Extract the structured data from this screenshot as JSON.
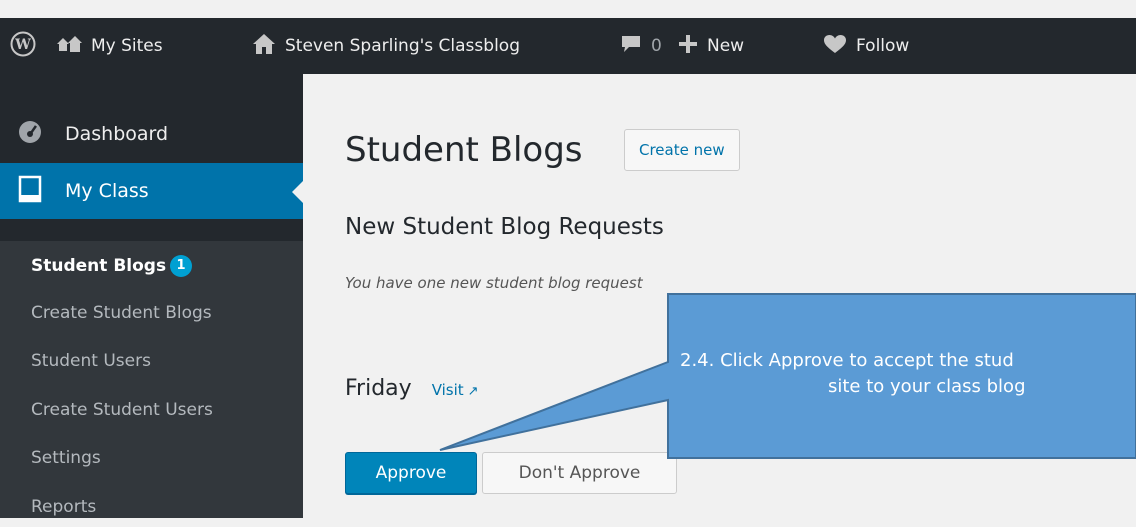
{
  "admin_bar": {
    "items": [
      {
        "icon": "wordpress-logo-icon",
        "label": ""
      },
      {
        "icon": "my-sites-icon",
        "label": "My Sites"
      },
      {
        "icon": "home-icon",
        "label": "Steven Sparling's Classblog"
      },
      {
        "icon": "comment-bubble-icon",
        "label": "0"
      },
      {
        "icon": "plus-icon",
        "label": "New"
      },
      {
        "icon": "heart-icon",
        "label": "Follow"
      }
    ]
  },
  "sidebar": {
    "menu": [
      {
        "icon": "dashboard-icon",
        "label": "Dashboard"
      },
      {
        "icon": "book-icon",
        "label": "My Class"
      }
    ],
    "submenu": [
      {
        "label": "Student Blogs",
        "badge": "1"
      },
      {
        "label": "Create Student Blogs"
      },
      {
        "label": "Student Users"
      },
      {
        "label": "Create Student Users"
      },
      {
        "label": "Settings"
      },
      {
        "label": "Reports"
      }
    ]
  },
  "main": {
    "title": "Student Blogs",
    "create_button": "Create new",
    "section_title": "New Student Blog Requests",
    "note": "You have one new student blog request",
    "request": {
      "name": "Friday",
      "visit_label": "Visit",
      "approve_label": "Approve",
      "dont_approve_label": "Don't Approve"
    }
  },
  "callout": {
    "line1": "2.4. Click Approve to accept the stud",
    "line2": "site to your class blog"
  },
  "colors": {
    "admin_bar": "#23282d",
    "sidebar": "#23282d",
    "submenu": "#32373c",
    "accent": "#0073aa",
    "approve": "#0085ba",
    "badge": "#00a0d2",
    "callout": "#5b9bd5"
  }
}
